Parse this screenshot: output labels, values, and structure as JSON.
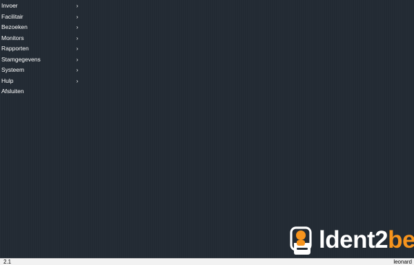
{
  "menu": {
    "items": [
      {
        "label": "Invoer",
        "submenu": true
      },
      {
        "label": "Facilitair",
        "submenu": true
      },
      {
        "label": "Bezoeken",
        "submenu": true
      },
      {
        "label": "Monitors",
        "submenu": true
      },
      {
        "label": "Rapporten",
        "submenu": true
      },
      {
        "label": "Stamgegevens",
        "submenu": true
      },
      {
        "label": "Systeem",
        "submenu": true
      },
      {
        "label": "Hulp",
        "submenu": true
      },
      {
        "label": "Afsluiten",
        "submenu": false
      }
    ],
    "chevron": "›"
  },
  "logo": {
    "text_main": "ldent2",
    "text_accent": "be",
    "icon": "id-card-icon",
    "colors": {
      "main": "#ffffff",
      "accent": "#f7941d"
    }
  },
  "statusbar": {
    "version": "2.1",
    "user": "leonard"
  },
  "colors": {
    "background": "#222a33",
    "menu_text": "#ffffff",
    "statusbar": "#f2f2f2"
  }
}
